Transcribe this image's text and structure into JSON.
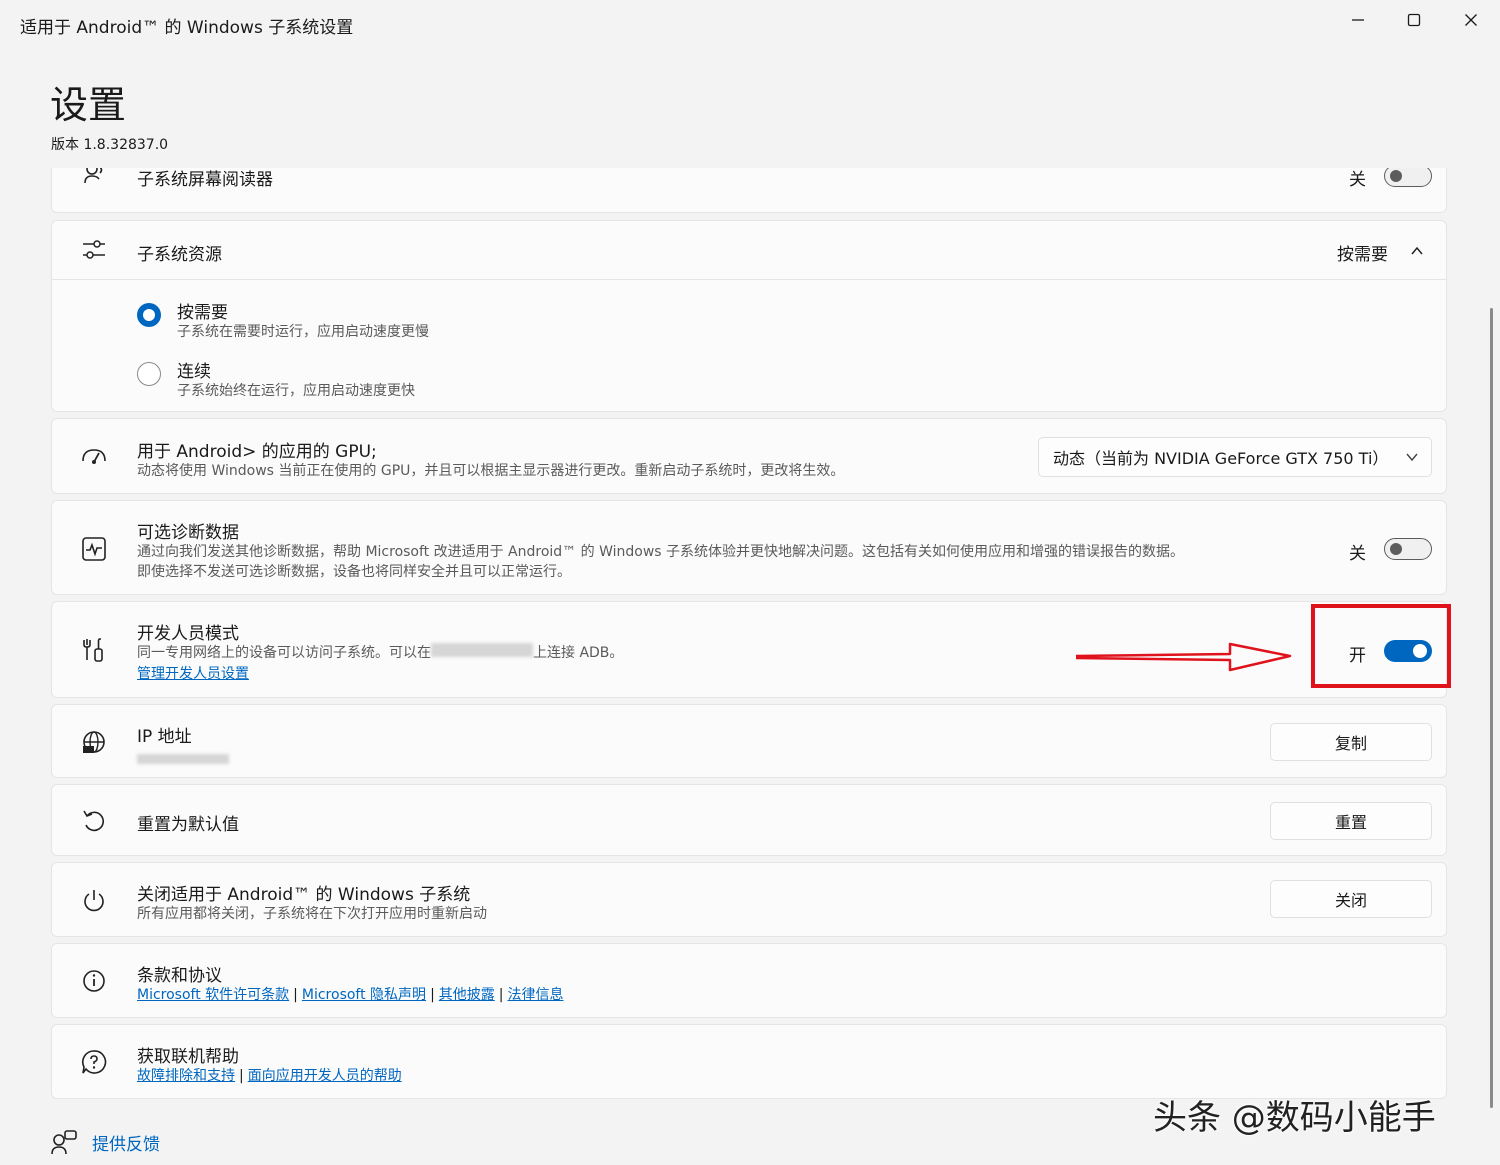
{
  "window": {
    "title": "适用于 Android™ 的 Windows 子系统设置"
  },
  "header": {
    "title": "设置",
    "version": "版本 1.8.32837.0"
  },
  "screen_reader": {
    "title": "子系统屏幕阅读器",
    "state": "关",
    "enabled": false
  },
  "resources": {
    "title": "子系统资源",
    "value": "按需要",
    "options": [
      {
        "label": "按需要",
        "desc": "子系统在需要时运行，应用启动速度更慢",
        "selected": true
      },
      {
        "label": "连续",
        "desc": "子系统始终在运行，应用启动速度更快",
        "selected": false
      }
    ]
  },
  "gpu": {
    "title": "用于 Android> 的应用的 GPU;",
    "desc": "动态将使用 Windows 当前正在使用的 GPU，并且可以根据主显示器进行更改。重新启动子系统时，更改将生效。",
    "value": "动态（当前为 NVIDIA GeForce GTX 750 Ti）"
  },
  "diagnostics": {
    "title": "可选诊断数据",
    "desc1": "通过向我们发送其他诊断数据，帮助 Microsoft 改进适用于 Android™ 的 Windows 子系统体验并更快地解决问题。这包括有关如何使用应用和增强的错误报告的数据。",
    "desc2": "即使选择不发送可选诊断数据，设备也将同样安全并且可以正常运行。",
    "state": "关",
    "enabled": false
  },
  "developer": {
    "title": "开发人员模式",
    "desc_prefix": "同一专用网络上的设备可以访问子系统。可以在",
    "desc_suffix": "上连接 ADB。",
    "link": "管理开发人员设置",
    "state": "开",
    "enabled": true
  },
  "ip": {
    "title": "IP 地址",
    "button": "复制"
  },
  "reset": {
    "title": "重置为默认值",
    "button": "重置"
  },
  "shutdown": {
    "title": "关闭适用于 Android™ 的 Windows 子系统",
    "desc": "所有应用都将关闭，子系统将在下次打开应用时重新启动",
    "button": "关闭"
  },
  "terms": {
    "title": "条款和协议",
    "links": [
      "Microsoft 软件许可条款",
      "Microsoft 隐私声明",
      "其他披露",
      "法律信息"
    ]
  },
  "help": {
    "title": "获取联机帮助",
    "links": [
      "故障排除和支持",
      "面向应用开发人员的帮助"
    ]
  },
  "feedback": {
    "label": "提供反馈"
  },
  "watermark": "头条 @数码小能手",
  "colors": {
    "accent": "#0067c0",
    "highlight_box": "#e0131c",
    "background": "#f3f3f3"
  }
}
